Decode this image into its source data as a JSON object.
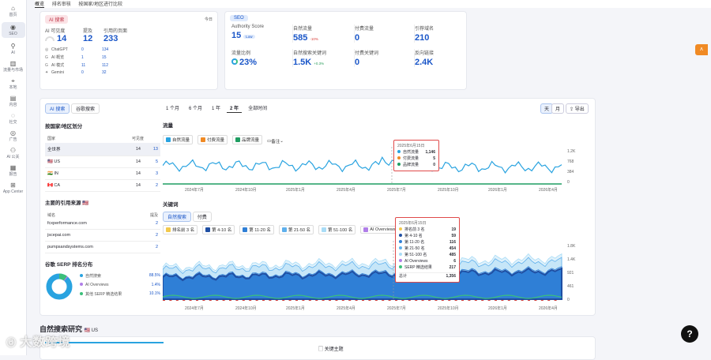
{
  "sidebar": [
    {
      "label": "首页",
      "icon": "home-icon",
      "glyph": "⌂"
    },
    {
      "label": "SEO",
      "icon": "seo-icon",
      "glyph": "◉",
      "active": true
    },
    {
      "label": "AI",
      "icon": "ai-icon",
      "glyph": "⚲"
    },
    {
      "label": "流量与市场",
      "icon": "traffic-icon",
      "glyph": "▥"
    },
    {
      "label": "本地",
      "icon": "local-icon",
      "glyph": "⌖"
    },
    {
      "label": "内容",
      "icon": "content-icon",
      "glyph": "▤"
    },
    {
      "label": "社交",
      "icon": "social-icon",
      "glyph": "◌"
    },
    {
      "label": "广告",
      "icon": "ads-icon",
      "glyph": "◎"
    },
    {
      "label": "AI 公关",
      "icon": "ai-pr-icon",
      "glyph": "⚇"
    },
    {
      "label": "报告",
      "icon": "report-icon",
      "glyph": "▦"
    },
    {
      "label": "App Center",
      "icon": "app-center-icon",
      "glyph": "⊞"
    }
  ],
  "tabs": [
    "概览",
    "排名审核",
    "按国家/地区进行比较"
  ],
  "ai_card": {
    "tag": "AI 搜索",
    "right": "今日",
    "col1": "AI 可见度",
    "col2": "提及",
    "col3": "引用的页面",
    "v1": "14",
    "v2": "12",
    "v3": "233",
    "rows": [
      {
        "name": "ChatGPT",
        "a": "0",
        "b": "134"
      },
      {
        "name": "AI 概览",
        "a": "1",
        "b": "15"
      },
      {
        "name": "AI 模式",
        "a": "11",
        "b": "112"
      },
      {
        "name": "Gemini",
        "a": "0",
        "b": "32"
      }
    ]
  },
  "seo_card": {
    "tag": "SEO",
    "m": [
      {
        "l": "Authority Score",
        "v": "15",
        "sub": "Low"
      },
      {
        "l": "自然流量",
        "v": "585",
        "sub": "-10%"
      },
      {
        "l": "付费流量",
        "v": "0",
        "sub": ""
      },
      {
        "l": "引荐域名",
        "v": "210",
        "sub": ""
      },
      {
        "l": "流量比例",
        "v": "23%",
        "sub": ""
      },
      {
        "l": "自然搜索关键词",
        "v": "1.5K",
        "sub": "+0.3%"
      },
      {
        "l": "付费关键词",
        "v": "0",
        "sub": ""
      },
      {
        "l": "反向链接",
        "v": "2.4K",
        "sub": ""
      }
    ]
  },
  "left": {
    "t1": "AI 搜索",
    "t2": "谷歌搜索",
    "country_title": "按国家/地区划分",
    "ch1": "国家",
    "ch2": "可见度",
    "countries": [
      {
        "n": "全世界",
        "a": "14",
        "b": "13",
        "flag": ""
      },
      {
        "n": "US",
        "a": "14",
        "b": "5",
        "flag": "🇺🇸"
      },
      {
        "n": "IN",
        "a": "14",
        "b": "3",
        "flag": "🇮🇳"
      },
      {
        "n": "CA",
        "a": "14",
        "b": "2",
        "flag": "🇨🇦"
      }
    ],
    "src_title": "主要的引用来源",
    "src_h1": "域名",
    "src_h2": "提及",
    "sources": [
      {
        "n": "fcxperformance.com",
        "v": "2"
      },
      {
        "n": "jscepai.com",
        "v": "2"
      },
      {
        "n": "pumpsandsystems.com",
        "v": "2"
      }
    ],
    "serp_title": "谷歌 SERP 排名分布",
    "serp": [
      {
        "n": "自然搜索",
        "v": "88.5%",
        "c": "#29a3e0"
      },
      {
        "n": "AI Overviews",
        "v": "1.4%",
        "c": "#b07ee8"
      },
      {
        "n": "其他 SERP 精选结果",
        "v": "10.1%",
        "c": "#3bbf7a"
      }
    ]
  },
  "chart": {
    "ranges": [
      "1 个月",
      "6 个月",
      "1 年",
      "2 年",
      "全部时间"
    ],
    "day": "天",
    "month": "月",
    "export": "导出",
    "traffic_title": "流量",
    "cb": [
      "自然流量",
      "付费流量",
      "品牌流量"
    ],
    "note": "备注",
    "ty": [
      "1.2K",
      "768",
      "384",
      "0"
    ],
    "tx": [
      "2024年7月",
      "2024年10月",
      "2025年1月",
      "2025年4月",
      "2025年7月",
      "2025年10月",
      "2026年1月",
      "2026年4月"
    ],
    "tip1": {
      "date": "2025年6月15日",
      "rows": [
        {
          "n": "自然流量",
          "v": "1,146",
          "c": "#29a3e0"
        },
        {
          "n": "付费流量",
          "v": "5",
          "c": "#f08a24"
        },
        {
          "n": "品牌流量",
          "v": "0",
          "c": "#1f9d62"
        }
      ]
    },
    "kw_title": "关键词",
    "kw_t1": "自然搜索",
    "kw_t2": "付费",
    "kwcb": [
      "排名前 3 名",
      "第 4-10 名",
      "第 11-20 名",
      "第 21-50 名",
      "第 51-100 名",
      "AI Overviews"
    ],
    "ky": [
      "1.8K",
      "1.4K",
      "921",
      "461",
      "0"
    ],
    "tip2": {
      "date": "2025年6月15日",
      "rows": [
        {
          "n": "排名前 3 名",
          "v": "19",
          "c": "#f2c94c"
        },
        {
          "n": "第 4-10 名",
          "v": "59",
          "c": "#1f4fa3"
        },
        {
          "n": "第 11-20 名",
          "v": "116",
          "c": "#2f7fd6"
        },
        {
          "n": "第 21-50 名",
          "v": "454",
          "c": "#5fb0ec"
        },
        {
          "n": "第 51-100 名",
          "v": "485",
          "c": "#a9dcf6"
        },
        {
          "n": "AI Overviews",
          "v": "6",
          "c": "#b07ee8"
        },
        {
          "n": "SERP 精选结果",
          "v": "217",
          "c": "#3bbf7a"
        }
      ],
      "total_l": "总计",
      "total_v": "1,356"
    }
  },
  "bottom": {
    "title": "自然搜索研究",
    "flag": "🇺🇸 US",
    "sub": "关键主题"
  },
  "watermark": "大数跨境",
  "help": "?"
}
